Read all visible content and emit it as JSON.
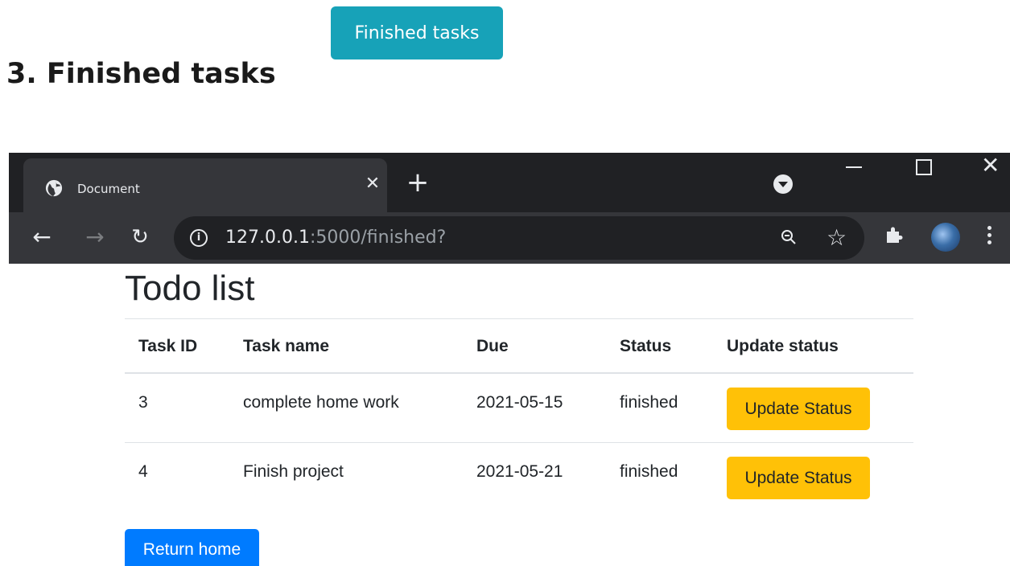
{
  "doc": {
    "top_button_label": "Finished tasks",
    "heading": "3. Finished tasks"
  },
  "browser": {
    "tab_title": "Document",
    "tab_close_glyph": "✕",
    "new_tab_glyph": "+",
    "url_host": "127.0.0.1",
    "url_rest": ":5000/finished?",
    "icons": [
      "globe-icon",
      "close-icon",
      "plus-icon",
      "tab-search-icon",
      "minimize-icon",
      "maximize-icon",
      "window-close-icon",
      "back-icon",
      "forward-icon",
      "reload-icon",
      "info-icon",
      "zoom-out-icon",
      "star-icon",
      "extensions-icon",
      "profile-avatar",
      "menu-icon"
    ]
  },
  "page": {
    "title": "Todo list",
    "table": {
      "headers": [
        "Task ID",
        "Task name",
        "Due",
        "Status",
        "Update status"
      ],
      "rows": [
        {
          "id": "3",
          "name": "complete home work",
          "due": "2021-05-15",
          "status": "finished",
          "action": "Update Status"
        },
        {
          "id": "4",
          "name": "Finish project",
          "due": "2021-05-21",
          "status": "finished",
          "action": "Update Status"
        }
      ]
    },
    "return_label": "Return home"
  },
  "colors": {
    "info_button": "#17a2b8",
    "warning_button": "#ffc107",
    "primary_button": "#007bff",
    "chrome_dark": "#202124",
    "chrome_toolbar": "#35363a"
  }
}
